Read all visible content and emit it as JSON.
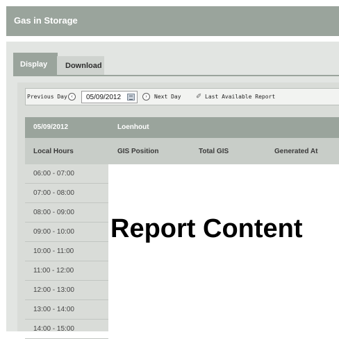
{
  "window": {
    "title": "Gas in Storage"
  },
  "tabs": [
    {
      "label": "Display",
      "active": true
    },
    {
      "label": "Download",
      "active": false
    }
  ],
  "datebar": {
    "prev_label": "Previous Day",
    "date_value": "05/09/2012",
    "next_label": "Next Day",
    "last_report_label": "Last Available Report"
  },
  "grid": {
    "header_date": "05/09/2012",
    "header_site": "Loenhout",
    "columns": [
      "Local Hours",
      "GIS Position",
      "Total GIS",
      "Generated At"
    ],
    "rows": [
      "06:00 - 07:00",
      "07:00 - 08:00",
      "08:00 - 09:00",
      "09:00 - 10:00",
      "10:00 - 11:00",
      "11:00 - 12:00",
      "12:00 - 13:00",
      "13:00 - 14:00",
      "14:00 - 15:00"
    ]
  },
  "report": {
    "placeholder": "Report Content"
  },
  "icons": {
    "prev": "chevron-left-icon",
    "next": "chevron-right-icon",
    "calendar": "calendar-icon",
    "report": "report-icon"
  },
  "colors": {
    "header": "#9aa49c",
    "panel": "#e2e5e2",
    "subheader": "#c8cdc8"
  }
}
